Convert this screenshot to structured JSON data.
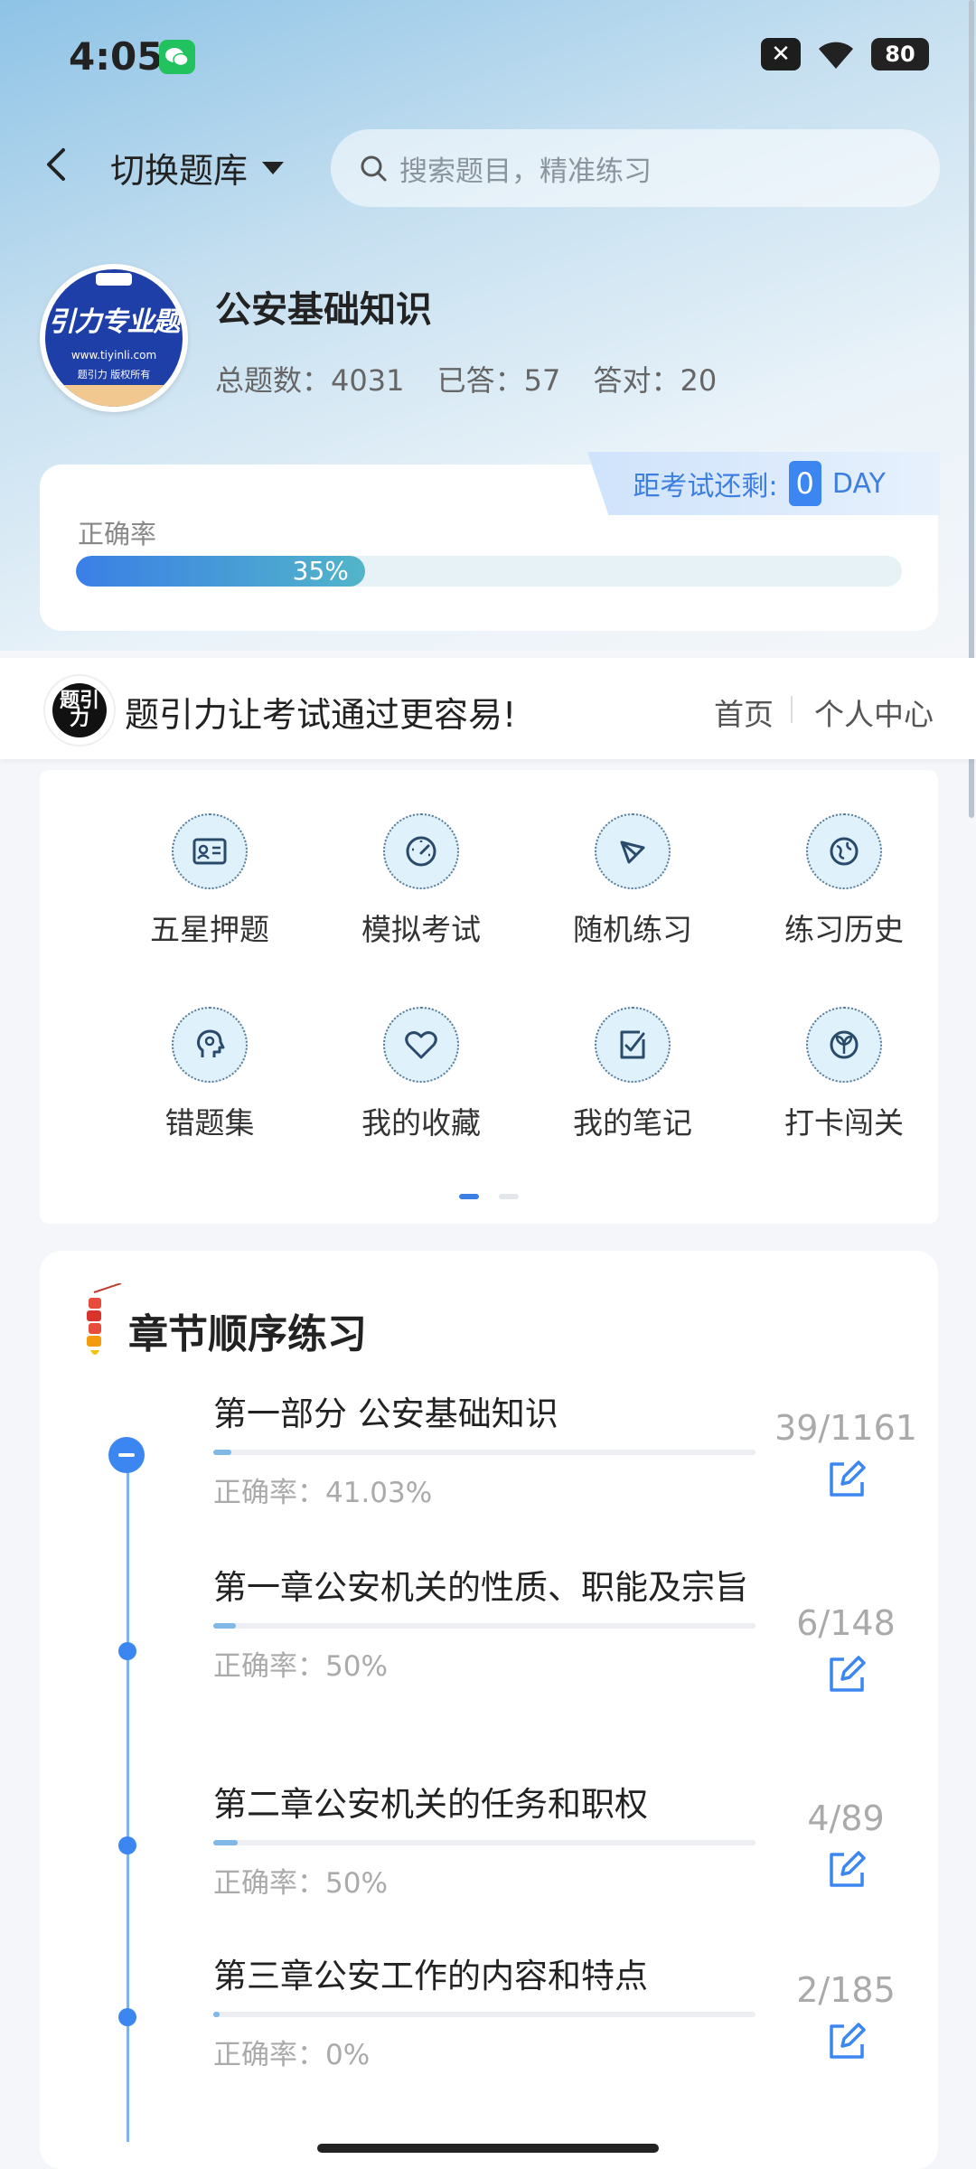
{
  "status_bar": {
    "time": "4:05",
    "battery": "80",
    "x_badge": "✕"
  },
  "header": {
    "switch_label": "切换题库",
    "search_placeholder": "搜索题目，精准练习"
  },
  "bank": {
    "logo_text": "引力专业题",
    "logo_url": "www.tiyinli.com",
    "logo_copy": "题引力 版权所有",
    "title": "公安基础知识",
    "total_label": "总题数：4031",
    "answered_label": "已答：57",
    "correct_label": "答对：20"
  },
  "accuracy": {
    "label": "正确率",
    "value_text": "35%",
    "value": 0.35,
    "countdown_label": "距考试还剩:",
    "countdown_days": "0",
    "countdown_unit": "DAY"
  },
  "slogan": {
    "logo_text": "题引力",
    "text": "题引力让考试通过更容易!",
    "nav_home": "首页",
    "nav_user": "个人中心"
  },
  "functions": [
    {
      "label": "五星押题",
      "icon": "id-card-icon"
    },
    {
      "label": "模拟考试",
      "icon": "gauge-icon"
    },
    {
      "label": "随机练习",
      "icon": "network-icon"
    },
    {
      "label": "练习历史",
      "icon": "globe-icon"
    },
    {
      "label": "错题集",
      "icon": "head-icon"
    },
    {
      "label": "我的收藏",
      "icon": "heart-icon"
    },
    {
      "label": "我的笔记",
      "icon": "note-check-icon"
    },
    {
      "label": "打卡闯关",
      "icon": "sprout-icon"
    }
  ],
  "chapters": {
    "title": "章节顺序练习",
    "items": [
      {
        "name": "第一部分 公安基础知识",
        "acc": "正确率：41.03%",
        "count": "39/1161",
        "progress": 0.034
      },
      {
        "name": "第一章公安机关的性质、职能及宗旨",
        "acc": "正确率：50%",
        "count": "6/148",
        "progress": 0.041
      },
      {
        "name": "第二章公安机关的任务和职权",
        "acc": "正确率：50%",
        "count": "4/89",
        "progress": 0.045
      },
      {
        "name": "第三章公安工作的内容和特点",
        "acc": "正确率：0%",
        "count": "2/185",
        "progress": 0.011
      }
    ]
  }
}
